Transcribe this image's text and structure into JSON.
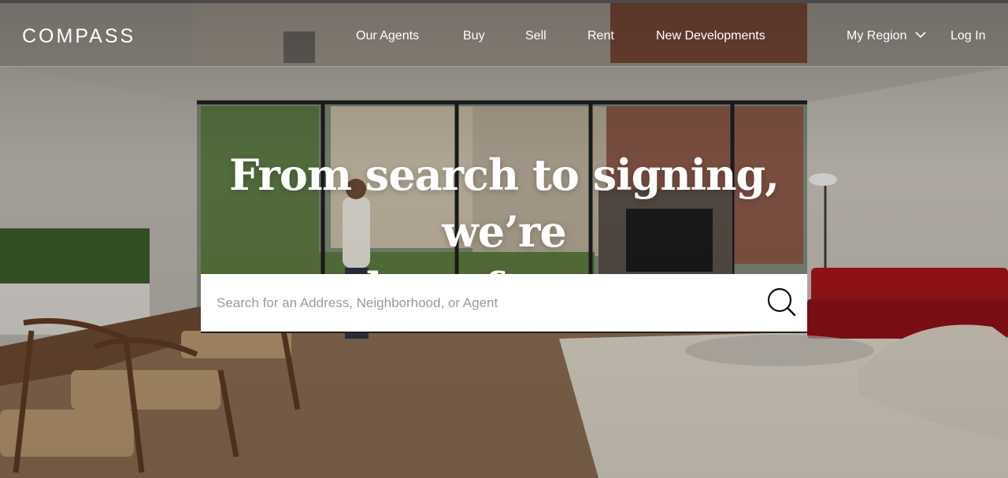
{
  "brand": {
    "logo_text": "COMPASS"
  },
  "nav": {
    "items": [
      {
        "label": "Our Agents"
      },
      {
        "label": "Buy"
      },
      {
        "label": "Sell"
      },
      {
        "label": "Rent"
      },
      {
        "label": "New Developments"
      }
    ],
    "region_label": "My Region",
    "login_label": "Log In"
  },
  "hero": {
    "headline_line1": "From search to signing, we’re",
    "headline_line2": "there for you.",
    "background": "interior-living-room-photo"
  },
  "search": {
    "placeholder": "Search for an Address, Neighborhood, or Agent",
    "value": "",
    "icon": "search-icon"
  },
  "colors": {
    "text": "#ffffff",
    "search_bg": "#ffffff",
    "placeholder": "#9a9a9a"
  }
}
